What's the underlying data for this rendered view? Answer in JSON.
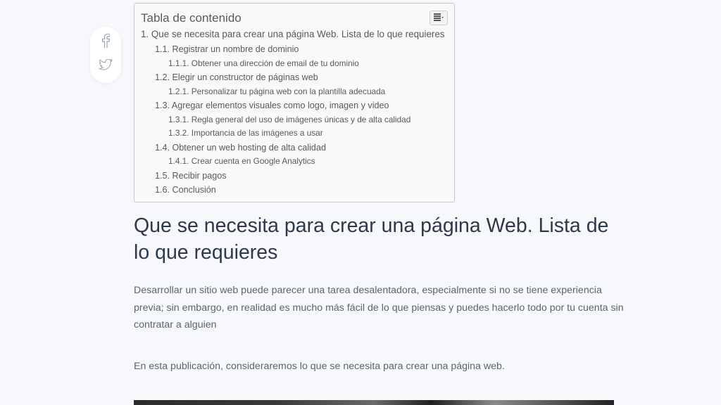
{
  "toc": {
    "title": "Tabla de contenido",
    "items": [
      {
        "label": "1. Que se necesita para crear una página Web. Lista de lo que requieres",
        "level": 1
      },
      {
        "label": "1.1. Registrar un nombre de dominio",
        "level": 2
      },
      {
        "label": "1.1.1. Obtener una dirección de email de tu dominio",
        "level": 3
      },
      {
        "label": "1.2. Elegir un constructor de páginas web",
        "level": 2
      },
      {
        "label": "1.2.1. Personalizar tu página web con la plantilla adecuada",
        "level": 3
      },
      {
        "label": "1.3. Agregar elementos visuales como logo, imagen y video",
        "level": 2
      },
      {
        "label": "1.3.1. Regla general del uso de imágenes únicas y de alta calidad",
        "level": 3
      },
      {
        "label": "1.3.2. Importancia de las imágenes a usar",
        "level": 3
      },
      {
        "label": "1.4. Obtener un web hosting de alta calidad",
        "level": 2
      },
      {
        "label": "1.4.1. Crear cuenta en Google Analytics",
        "level": 3
      },
      {
        "label": "1.5. Recibir pagos",
        "level": 2
      },
      {
        "label": "1.6. Conclusión",
        "level": 2
      }
    ],
    "toggle_icon": "list-toggle-icon"
  },
  "share": {
    "icons": [
      "facebook-icon",
      "twitter-icon"
    ],
    "color": "#9aa4b1"
  },
  "article": {
    "heading": "Que se necesita para crear una página Web. Lista de lo que requieres",
    "paragraphs": [
      "Desarrollar un sitio web puede parecer una tarea desalentadora, especialmente si no se tiene experiencia previa; sin embargo, en realidad es mucho más fácil de lo que piensas y puedes hacerlo todo por tu cuenta sin contratar a alguien",
      "En esta publicación, consideraremos lo que se necesita para crear una página web."
    ]
  },
  "colors": {
    "background": "#f6f8fb",
    "heading": "#2c3a4a",
    "text": "#5b6470"
  }
}
